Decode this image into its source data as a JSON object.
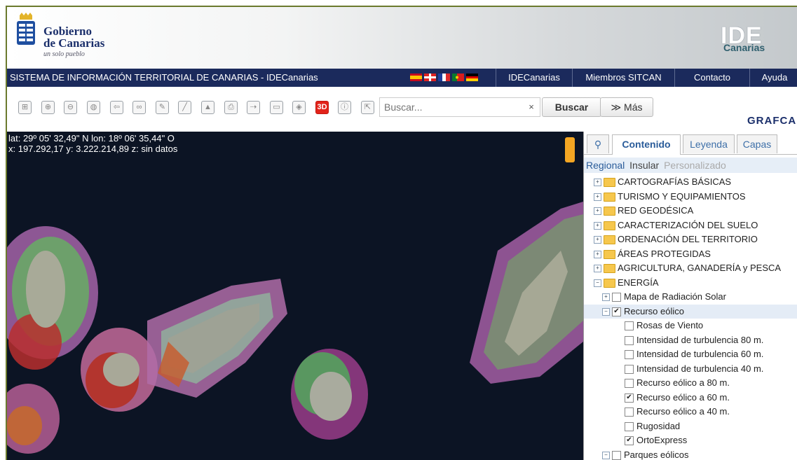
{
  "header": {
    "logo_line1": "Gobierno",
    "logo_line2": "de Canarias",
    "logo_tagline": "un solo pueblo",
    "ide_logo": "IDE",
    "ide_logo_sub": "Canarias"
  },
  "navbar": {
    "title": "SISTEMA DE INFORMACIÓN TERRITORIAL DE CANARIAS - IDECanarias",
    "items": [
      "IDECanarias",
      "Miembros SITCAN",
      "Contacto",
      "Ayuda"
    ]
  },
  "toolbar": {
    "tool_icons": [
      "zoom-box-icon",
      "zoom-in-icon",
      "zoom-out-icon",
      "globe-icon",
      "back-icon",
      "link-icon",
      "draw-icon",
      "measure-icon",
      "profile-icon",
      "print-icon",
      "export-icon",
      "scale-icon",
      "layers-icon",
      "3d-icon",
      "info-icon",
      "share-icon"
    ],
    "label_3d": "3D",
    "search_placeholder": "Buscar...",
    "search_clear": "×",
    "search_button": "Buscar",
    "more_button": "≫ Más",
    "grafcan_logo": "GRAFCAN"
  },
  "map": {
    "coords_line1": "lat: 29º 05' 32,49\" N  lon: 18º 06' 35,44\" O",
    "coords_line2": "x: 197.292,17  y: 3.222.214,89  z: sin datos"
  },
  "panel": {
    "tabs": [
      "Contenido",
      "Leyenda",
      "Capas"
    ],
    "subtabs": [
      "Regional",
      "Insular",
      "Personalizado"
    ],
    "tree": [
      {
        "label": "CARTOGRAFÍAS BÁSICAS",
        "level": 0,
        "kind": "folder"
      },
      {
        "label": "TURISMO Y EQUIPAMIENTOS",
        "level": 0,
        "kind": "folder"
      },
      {
        "label": "RED GEODÉSICA",
        "level": 0,
        "kind": "folder"
      },
      {
        "label": "CARACTERIZACIÓN DEL SUELO",
        "level": 0,
        "kind": "folder"
      },
      {
        "label": "ORDENACIÓN DEL TERRITORIO",
        "level": 0,
        "kind": "folder"
      },
      {
        "label": "ÁREAS PROTEGIDAS",
        "level": 0,
        "kind": "folder"
      },
      {
        "label": "AGRICULTURA, GANADERÍA y PESCA",
        "level": 0,
        "kind": "folder"
      },
      {
        "label": "ENERGÍA",
        "level": 0,
        "kind": "folder-open"
      },
      {
        "label": "Mapa de Radiación Solar",
        "level": 1,
        "kind": "group",
        "checked": false
      },
      {
        "label": "Recurso eólico",
        "level": 1,
        "kind": "group-open",
        "checked": true
      },
      {
        "label": "Rosas de Viento",
        "level": 2,
        "kind": "layer",
        "checked": false
      },
      {
        "label": "Intensidad de turbulencia 80 m.",
        "level": 2,
        "kind": "layer",
        "checked": false
      },
      {
        "label": "Intensidad de turbulencia 60 m.",
        "level": 2,
        "kind": "layer",
        "checked": false
      },
      {
        "label": "Intensidad de turbulencia 40 m.",
        "level": 2,
        "kind": "layer",
        "checked": false
      },
      {
        "label": "Recurso eólico a 80 m.",
        "level": 2,
        "kind": "layer",
        "checked": false
      },
      {
        "label": "Recurso eólico a 60 m.",
        "level": 2,
        "kind": "layer",
        "checked": true
      },
      {
        "label": "Recurso eólico a 40 m.",
        "level": 2,
        "kind": "layer",
        "checked": false
      },
      {
        "label": "Rugosidad",
        "level": 2,
        "kind": "layer",
        "checked": false
      },
      {
        "label": "OrtoExpress",
        "level": 2,
        "kind": "layer",
        "checked": true
      },
      {
        "label": "Parques eólicos",
        "level": 1,
        "kind": "group-open",
        "checked": false
      }
    ]
  }
}
